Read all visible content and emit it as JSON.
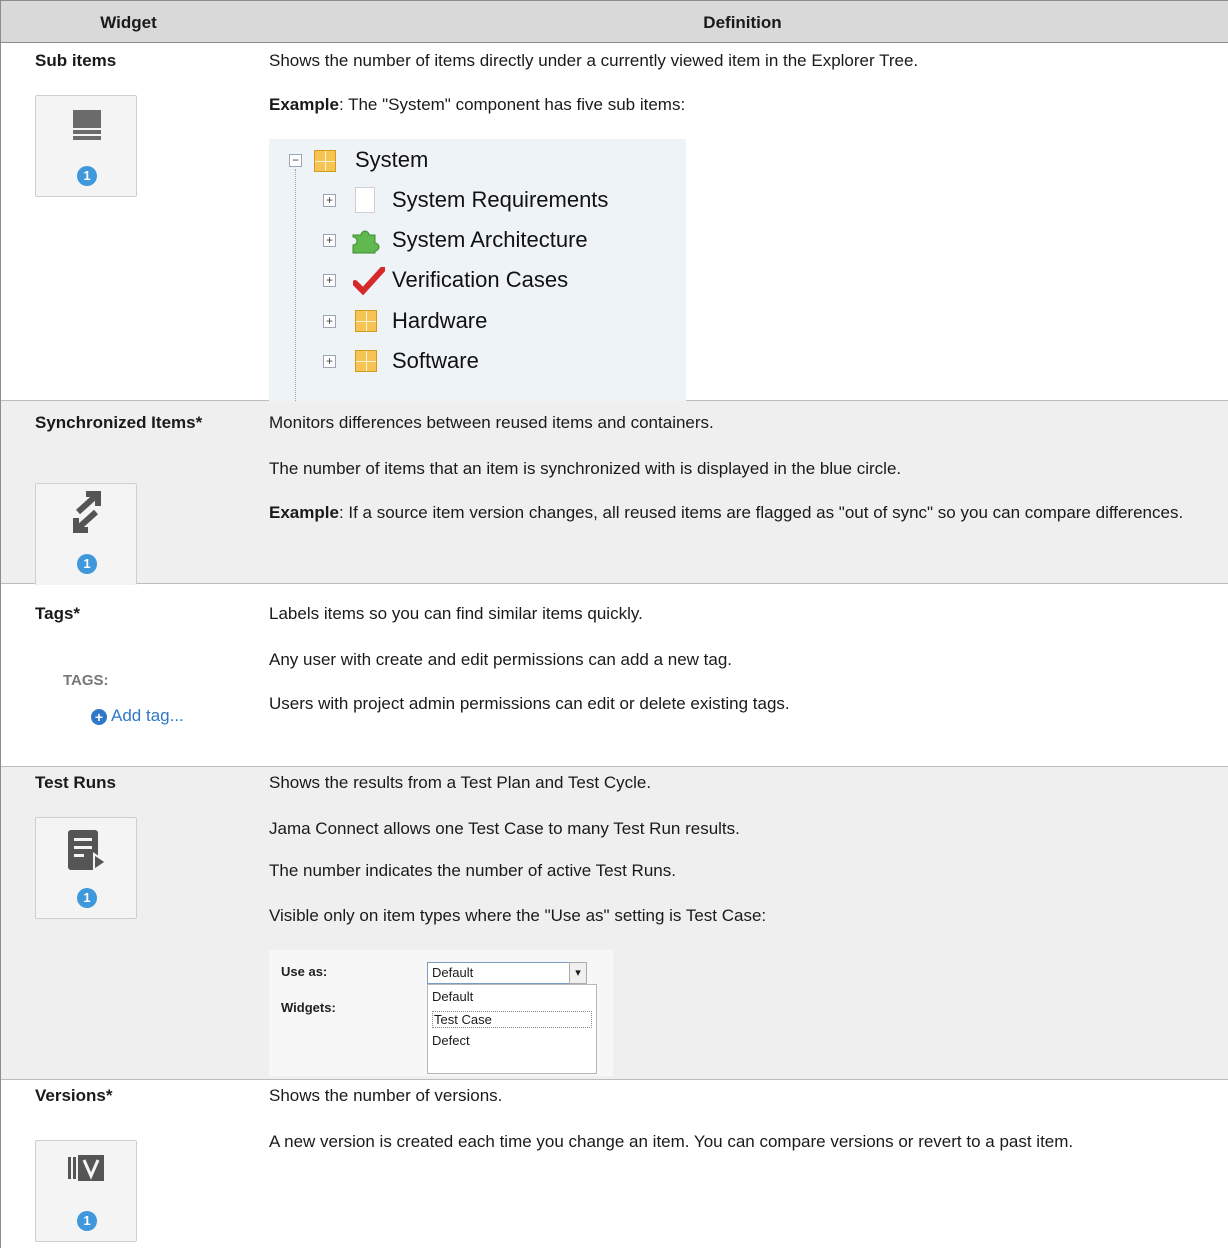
{
  "header": {
    "widget": "Widget",
    "definition": "Definition"
  },
  "rows": {
    "sub_items": {
      "name": "Sub items",
      "p1": "Shows the number of items directly under a currently viewed item in the Explorer Tree.",
      "example_label": "Example",
      "example_text": ": The \"System\" component has five sub items:",
      "badge": "1",
      "tree": {
        "root": "System",
        "children": [
          "System Requirements",
          "System Architecture",
          "Verification Cases",
          "Hardware",
          "Software"
        ]
      }
    },
    "synchronized": {
      "name": "Synchronized Items*",
      "p1": "Monitors differences between reused items and containers.",
      "p2": "The number of items that an item is synchronized with is displayed in the blue circle.",
      "example_label": "Example",
      "example_text": ": If a source item version changes, all reused items are flagged as \"out of sync\" so you can compare differences.",
      "badge": "1"
    },
    "tags": {
      "name": "Tags*",
      "p1": "Labels items so you can find similar items quickly.",
      "p2": "Any user with create and edit permissions can add a new tag.",
      "p3": "Users with project admin permissions can edit or delete existing tags.",
      "tags_label": "TAGS:",
      "add_tag": "Add tag..."
    },
    "test_runs": {
      "name": "Test Runs",
      "p1": "Shows the results from a Test Plan and Test Cycle.",
      "p2": "Jama Connect allows one Test Case to many Test Run results.",
      "p3": "The number indicates the number of active Test Runs.",
      "p4": "Visible only on item types where the \"Use as\" setting is Test Case:",
      "badge": "1",
      "dropdown": {
        "use_as_label": "Use as:",
        "widgets_label": "Widgets:",
        "selected": "Default",
        "options": [
          "Default",
          "Test Case",
          "Defect"
        ]
      }
    },
    "versions": {
      "name": "Versions*",
      "p1": "Shows the number of versions.",
      "p2": "A new version is created each time you change an item. You can compare versions or revert to a past item.",
      "badge": "1"
    }
  }
}
